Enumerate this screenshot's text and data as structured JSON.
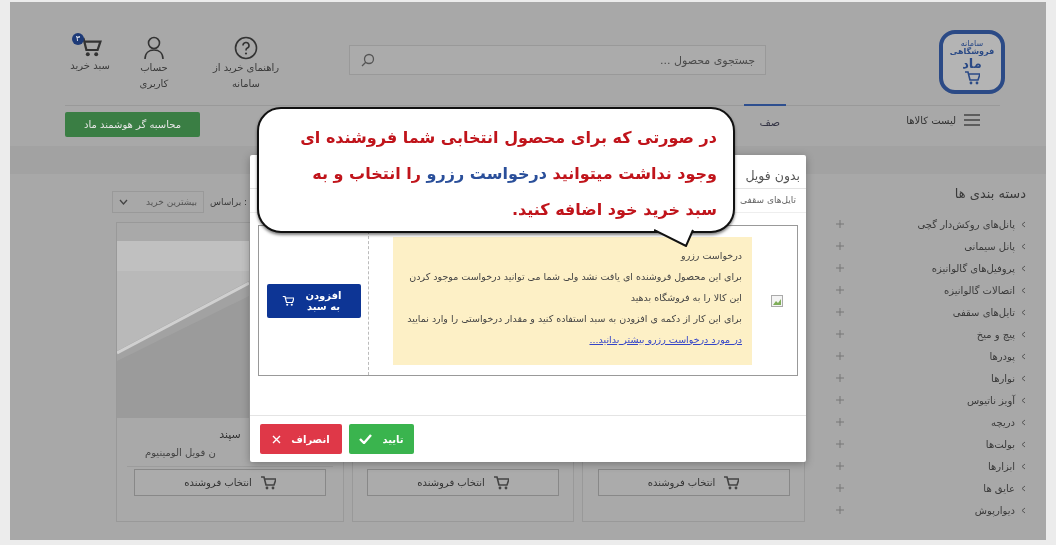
{
  "logo": {
    "lines": [
      "سامانه",
      "فروشگاهی",
      "ماد"
    ]
  },
  "search": {
    "placeholder": "جستجوی محصول ..."
  },
  "header_links": [
    {
      "kind": "help",
      "label": "راهنمای خرید از سامانه"
    },
    {
      "kind": "account",
      "label": "حساب کاربری"
    },
    {
      "kind": "cart",
      "label": "سبد خرید",
      "badge": "۳"
    }
  ],
  "nav": {
    "menu_label": "لیست کالاها",
    "tabs": [
      {
        "label": "صف",
        "selected": true
      }
    ],
    "calculator_button": "محاسبه گر هوشمند ماد"
  },
  "sidebar": {
    "title": "دسته بندی ها",
    "items": [
      "پانل‌های روکش‌دار گچی",
      "پانل سیمانی",
      "پروفیل‌های گالوانیزه",
      "اتصالات گالوانیزه",
      "تایل‌های سقفی",
      "پیچ و میخ",
      "پودرها",
      "نوارها",
      "آویز ناتیوس",
      "دریچه",
      "بولت‌ها",
      "ابزارها",
      "عایق ها",
      "دیوارپوش"
    ]
  },
  "sort": {
    "label": "براساس :",
    "value": "بیشترین خرید"
  },
  "products": [
    {
      "kind": "hidden",
      "button": "انتخاب فروشنده"
    },
    {
      "kind": "hidden",
      "button": "انتخاب فروشنده"
    },
    {
      "kind": "picture",
      "name": "سپند",
      "subtitle": "ن فویل الومینیوم",
      "button": "انتخاب فروشنده"
    }
  ],
  "modal": {
    "title": "بدون فویل",
    "breadcrumb": "تایل‌های سقفی",
    "notice": {
      "title": "درخواست رزرو",
      "lines": [
        "برای این محصول فروشنده ای یافت نشد ولی شما می توانید درخواست موجود کردن این کالا را به فروشگاه بدهید",
        "برای این کار از دکمه ی افزودن به سبد استفاده کنید و مقدار درخواستی را وارد نمایید"
      ],
      "link": "در مورد درخواست رزرو بیشتر بدانید..."
    },
    "add_button": "افزودن به سبد",
    "confirm_button": "تایید",
    "cancel_button": "انصراف"
  },
  "callout": {
    "segments": [
      {
        "kind": "normal",
        "text": "در صورتی که برای محصول انتخابی شما فروشنده ای وجود نداشت میتوانید "
      },
      {
        "kind": "highlight",
        "text": "درخواست رزرو"
      },
      {
        "kind": "normal",
        "text": " را انتخاب  و به سبد خرید خود اضافه کنید."
      }
    ]
  }
}
